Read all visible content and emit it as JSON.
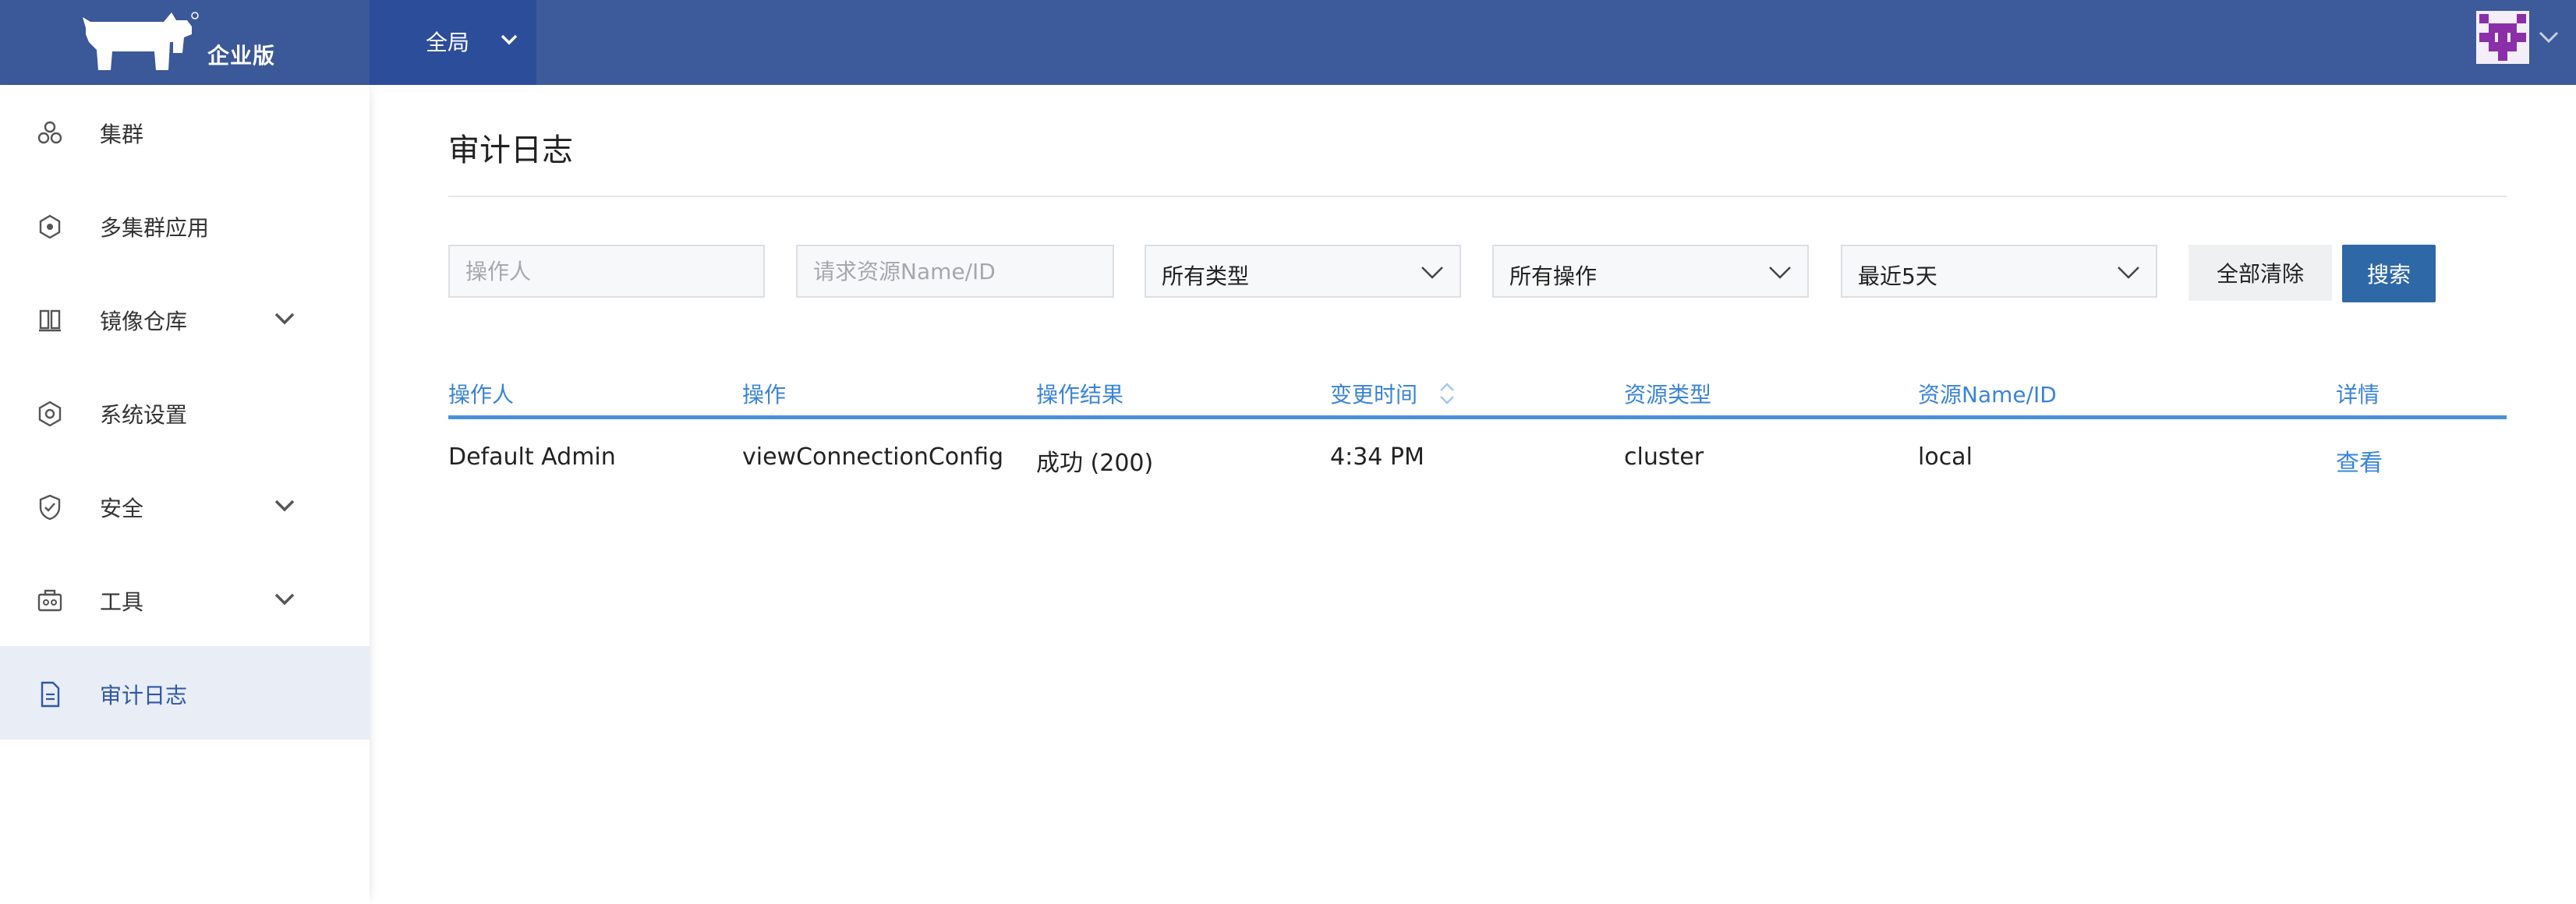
{
  "header": {
    "brand_text": "企业版",
    "scope_label": "全局",
    "colors": {
      "topbar": "#3d5a9a",
      "scope": "#2c4d99",
      "accent": "#3a84d6"
    }
  },
  "sidebar": {
    "items": [
      {
        "label": "集群",
        "icon": "cluster-icon",
        "expandable": false
      },
      {
        "label": "多集群应用",
        "icon": "multicluster-app-icon",
        "expandable": false
      },
      {
        "label": "镜像仓库",
        "icon": "registry-icon",
        "expandable": true
      },
      {
        "label": "系统设置",
        "icon": "settings-icon",
        "expandable": false
      },
      {
        "label": "安全",
        "icon": "shield-icon",
        "expandable": true
      },
      {
        "label": "工具",
        "icon": "toolbox-icon",
        "expandable": true
      },
      {
        "label": "审计日志",
        "icon": "document-icon",
        "expandable": false,
        "active": true
      }
    ]
  },
  "page": {
    "title": "审计日志"
  },
  "filters": {
    "operator_placeholder": "操作人",
    "resource_placeholder": "请求资源Name/ID",
    "type_selected": "所有类型",
    "action_selected": "所有操作",
    "time_selected": "最近5天",
    "clear_label": "全部清除",
    "search_label": "搜索"
  },
  "table": {
    "columns": [
      "操作人",
      "操作",
      "操作结果",
      "变更时间",
      "资源类型",
      "资源Name/ID",
      "详情"
    ],
    "rows": [
      {
        "operator": "Default Admin",
        "action": "viewConnectionConfig",
        "result": "成功 (200)",
        "time": "4:34 PM",
        "resource_type": "cluster",
        "resource_id": "local",
        "detail": "查看"
      }
    ]
  }
}
